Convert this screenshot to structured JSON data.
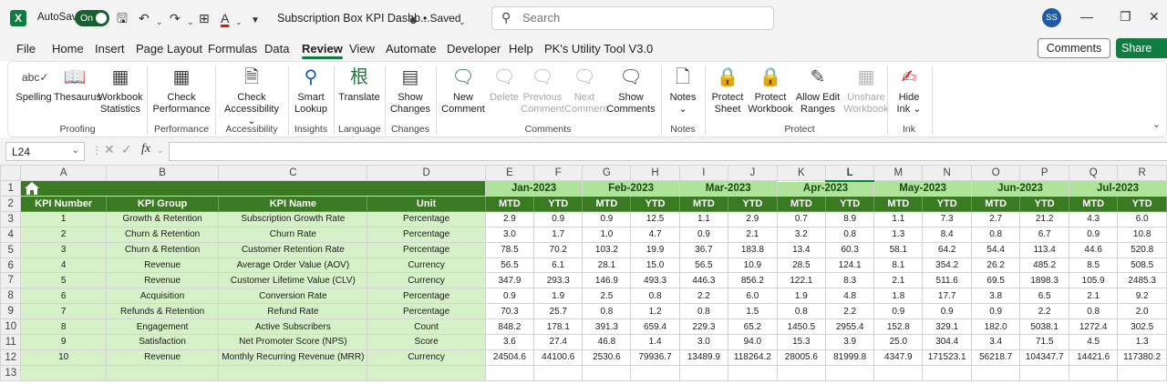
{
  "titlebar": {
    "autosave_label": "AutoSave",
    "autosave_state": "On",
    "doc_title": "Subscription Box KPI Dashb...",
    "saved_label": "• Saved",
    "search_placeholder": "Search",
    "user_initials": "SS"
  },
  "menu": {
    "tabs": [
      "File",
      "Home",
      "Insert",
      "Page Layout",
      "Formulas",
      "Data",
      "Review",
      "View",
      "Automate",
      "Developer",
      "Help",
      "PK's Utility Tool V3.0"
    ],
    "active_tab": "Review",
    "comments_button": "Comments",
    "share_button": "Share"
  },
  "ribbon": {
    "spelling": "Spelling",
    "thesaurus": "Thesaurus",
    "workbook_statistics": [
      "Workbook",
      "Statistics"
    ],
    "proofing_group": "Proofing",
    "check_performance": [
      "Check",
      "Performance"
    ],
    "performance_group": "Performance",
    "check_accessibility": [
      "Check",
      "Accessibility"
    ],
    "accessibility_group": "Accessibility",
    "smart_lookup": [
      "Smart",
      "Lookup"
    ],
    "insights_group": "Insights",
    "translate": "Translate",
    "language_group": "Language",
    "show_changes": [
      "Show",
      "Changes"
    ],
    "changes_group": "Changes",
    "new_comment": [
      "New",
      "Comment"
    ],
    "delete": "Delete",
    "previous_comment": [
      "Previous",
      "Comment"
    ],
    "next_comment": [
      "Next",
      "Comment"
    ],
    "show_comments": [
      "Show",
      "Comments"
    ],
    "comments_group": "Comments",
    "notes": "Notes",
    "notes_group": "Notes",
    "protect_sheet": [
      "Protect",
      "Sheet"
    ],
    "protect_workbook": [
      "Protect",
      "Workbook"
    ],
    "allow_edit_ranges": [
      "Allow Edit",
      "Ranges"
    ],
    "unshare_workbook": [
      "Unshare",
      "Workbook"
    ],
    "protect_group": "Protect",
    "hide_ink": [
      "Hide",
      "Ink"
    ],
    "ink_group": "Ink"
  },
  "formula_bar": {
    "name_box": "L24",
    "fx": "fx",
    "formula": ""
  },
  "sheet": {
    "columns": [
      "A",
      "B",
      "C",
      "D",
      "E",
      "F",
      "G",
      "H",
      "I",
      "J",
      "K",
      "L",
      "M",
      "N",
      "O",
      "P",
      "Q",
      "R"
    ],
    "selected_column": "L",
    "row_numbers": [
      "1",
      "2",
      "3",
      "4",
      "5",
      "6",
      "7",
      "8",
      "9",
      "10",
      "11",
      "12",
      "13"
    ],
    "months": [
      "Jan-2023",
      "Feb-2023",
      "Mar-2023",
      "Apr-2023",
      "May-2023",
      "Jun-2023",
      "Jul-2023"
    ],
    "headers": [
      "KPI Number",
      "KPI Group",
      "KPI Name",
      "Unit"
    ],
    "sub_headers": [
      "MTD",
      "YTD"
    ],
    "rows": [
      {
        "num": "1",
        "group": "Growth & Retention",
        "name": "Subscription Growth Rate",
        "unit": "Percentage",
        "values": [
          "2.9",
          "0.9",
          "0.9",
          "12.5",
          "1.1",
          "2.9",
          "0.7",
          "8.9",
          "1.1",
          "7.3",
          "2.7",
          "21.2",
          "4.3",
          "6.0"
        ]
      },
      {
        "num": "2",
        "group": "Churn & Retention",
        "name": "Churn Rate",
        "unit": "Percentage",
        "values": [
          "3.0",
          "1.7",
          "1.0",
          "4.7",
          "0.9",
          "2.1",
          "3.2",
          "0.8",
          "1.3",
          "8.4",
          "0.8",
          "6.7",
          "0.9",
          "10.8"
        ]
      },
      {
        "num": "3",
        "group": "Churn & Retention",
        "name": "Customer Retention Rate",
        "unit": "Percentage",
        "values": [
          "78.5",
          "70.2",
          "103.2",
          "19.9",
          "36.7",
          "183.8",
          "13.4",
          "60.3",
          "58.1",
          "64.2",
          "54.4",
          "113.4",
          "44.6",
          "520.8"
        ]
      },
      {
        "num": "4",
        "group": "Revenue",
        "name": "Average Order Value (AOV)",
        "unit": "Currency",
        "values": [
          "56.5",
          "6.1",
          "28.1",
          "15.0",
          "56.5",
          "10.9",
          "28.5",
          "124.1",
          "8.1",
          "354.2",
          "26.2",
          "485.2",
          "8.5",
          "508.5"
        ]
      },
      {
        "num": "5",
        "group": "Revenue",
        "name": "Customer Lifetime Value (CLV)",
        "unit": "Currency",
        "values": [
          "347.9",
          "293.3",
          "146.9",
          "493.3",
          "446.3",
          "856.2",
          "122.1",
          "8.3",
          "2.1",
          "511.6",
          "69.5",
          "1898.3",
          "105.9",
          "2485.3"
        ]
      },
      {
        "num": "6",
        "group": "Acquisition",
        "name": "Conversion Rate",
        "unit": "Percentage",
        "values": [
          "0.9",
          "1.9",
          "2.5",
          "0.8",
          "2.2",
          "6.0",
          "1.9",
          "4.8",
          "1.8",
          "17.7",
          "3.8",
          "6.5",
          "2.1",
          "9.2"
        ]
      },
      {
        "num": "7",
        "group": "Refunds & Retention",
        "name": "Refund Rate",
        "unit": "Percentage",
        "values": [
          "70.3",
          "25.7",
          "0.8",
          "1.2",
          "0.8",
          "1.5",
          "0.8",
          "2.2",
          "0.9",
          "0.9",
          "0.9",
          "2.2",
          "0.8",
          "2.0"
        ]
      },
      {
        "num": "8",
        "group": "Engagement",
        "name": "Active Subscribers",
        "unit": "Count",
        "values": [
          "848.2",
          "178.1",
          "391.3",
          "659.4",
          "229.3",
          "65.2",
          "1450.5",
          "2955.4",
          "152.8",
          "329.1",
          "182.0",
          "5038.1",
          "1272.4",
          "302.5"
        ]
      },
      {
        "num": "9",
        "group": "Satisfaction",
        "name": "Net Promoter Score (NPS)",
        "unit": "Score",
        "values": [
          "3.6",
          "27.4",
          "46.8",
          "1.4",
          "3.0",
          "94.0",
          "15.3",
          "3.9",
          "25.0",
          "304.4",
          "3.4",
          "71.5",
          "4.5",
          "1.3"
        ]
      },
      {
        "num": "10",
        "group": "Revenue",
        "name": "Monthly Recurring Revenue (MRR)",
        "unit": "Currency",
        "values": [
          "24504.6",
          "44100.6",
          "2530.6",
          "79936.7",
          "13489.9",
          "118264.2",
          "28005.6",
          "81999.8",
          "4347.9",
          "171523.1",
          "56218.7",
          "104347.7",
          "14421.6",
          "117380.2"
        ]
      }
    ]
  }
}
